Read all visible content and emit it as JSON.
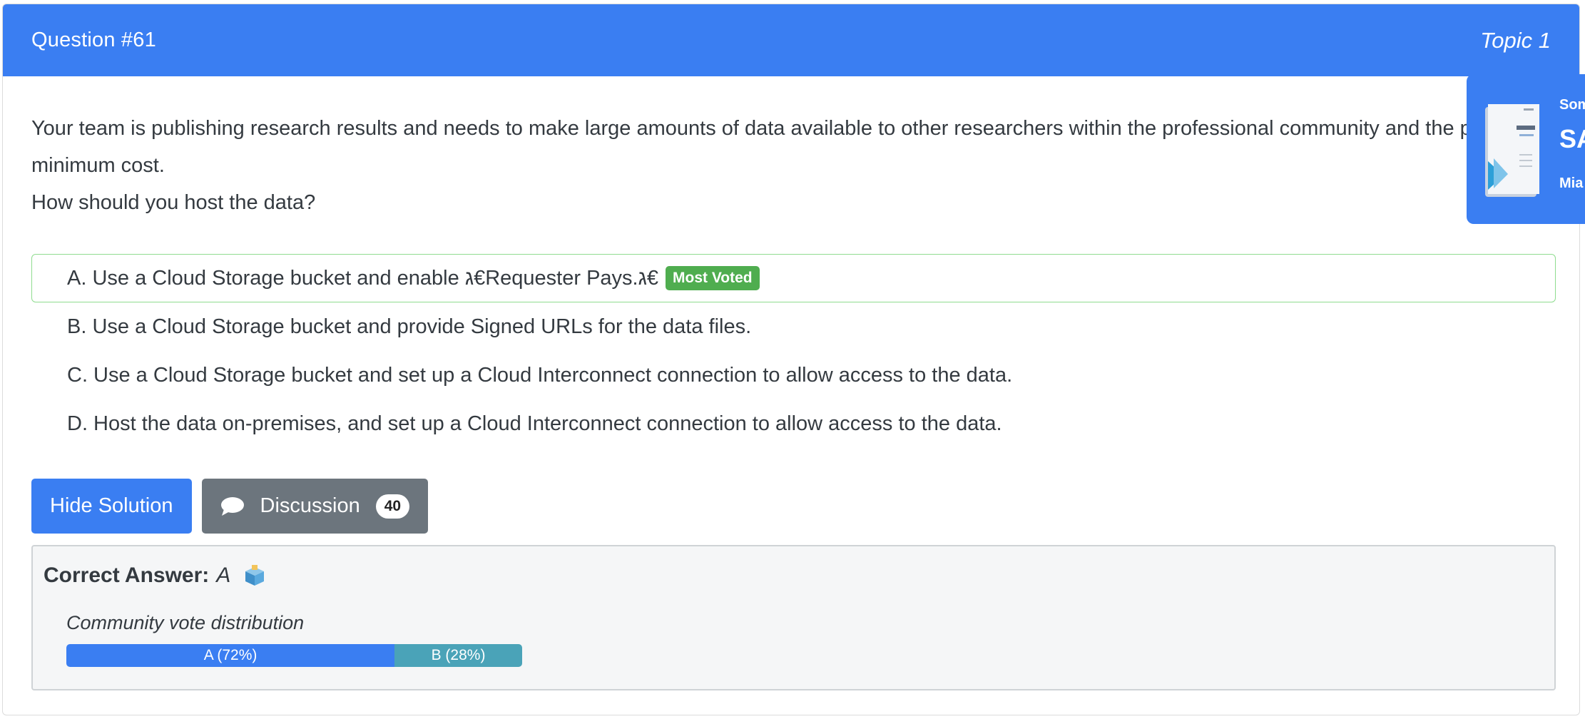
{
  "header": {
    "question_number": "Question #61",
    "topic": "Topic 1"
  },
  "question": {
    "line1": "Your team is publishing research results and needs to make large amounts of data available to other researchers within the professional community and the pub",
    "line2": "minimum cost.",
    "line3": "How should you host the data?"
  },
  "choices": [
    {
      "text": "A. Use a Cloud Storage bucket and enable ג€Requester Pays.ג€",
      "badge": "Most Voted"
    },
    {
      "text": "B. Use a Cloud Storage bucket and provide Signed URLs for the data files."
    },
    {
      "text": "C. Use a Cloud Storage bucket and set up a Cloud Interconnect connection to allow access to the data."
    },
    {
      "text": "D. Host the data on-premises, and set up a Cloud Interconnect connection to allow access to the data."
    }
  ],
  "buttons": {
    "hide_solution": "Hide Solution",
    "discussion": "Discussion",
    "discussion_count": "40"
  },
  "answer": {
    "label": "Correct Answer:",
    "value": "A",
    "vote_title": "Community vote distribution",
    "votes": [
      {
        "label": "A (72%)",
        "percent": 72,
        "color": "#3a7ef2"
      },
      {
        "label": "B (28%)",
        "percent": 28,
        "color": "#4aa3b8"
      }
    ]
  },
  "promo": {
    "line1": "Som",
    "line2": "SA",
    "line3": "Mia"
  },
  "colors": {
    "primary": "#3a7ef2",
    "secondary": "#6c757d",
    "success": "#4fad4f",
    "vote_b": "#4aa3b8"
  }
}
